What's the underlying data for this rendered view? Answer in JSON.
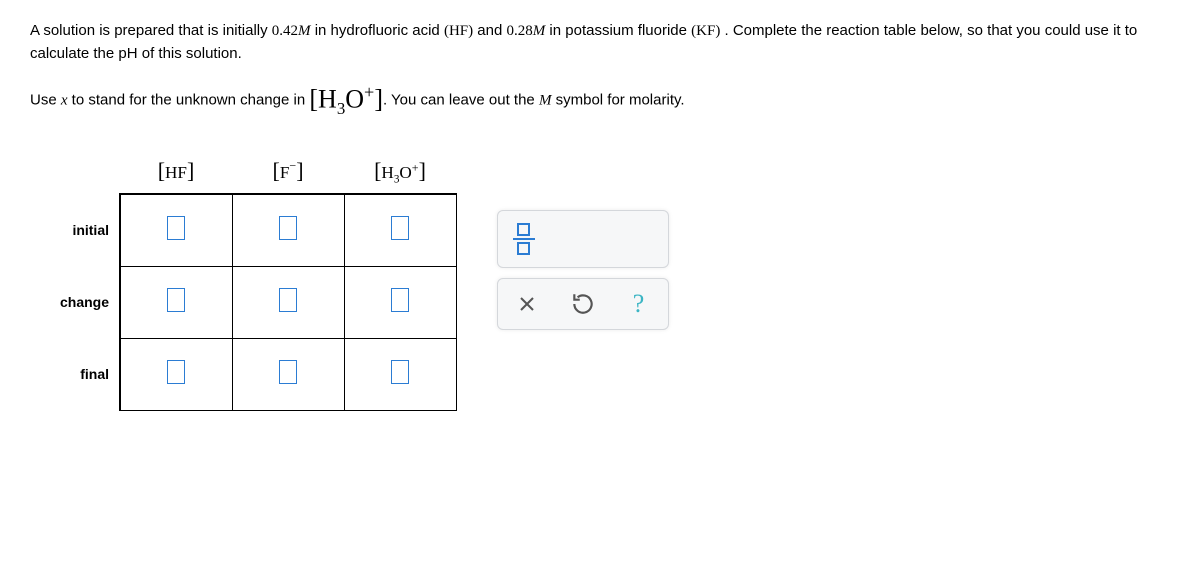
{
  "problem": {
    "part1": "A solution is prepared that is initially ",
    "conc1": "0.42",
    "unit1": "M",
    "part2": " in hydrofluoric acid ",
    "species1": "(HF)",
    "part3": "  and ",
    "conc2": "0.28",
    "unit2": "M",
    "part4": " in potassium fluoride ",
    "species2": "(KF)",
    "part5": " . Complete the reaction table below, so that you could use it to calculate the pH of this solution.",
    "line2a": "Use ",
    "xvar": "x",
    "line2b": " to stand for the unknown change in ",
    "h3o": "H",
    "h3osub": "3",
    "h3oo": "O",
    "h3osup": "+",
    "line2c": ". You can leave out the ",
    "Msym": "M",
    "line2d": " symbol for molarity."
  },
  "table": {
    "col_hf_l": "[",
    "col_hf_inner": "HF",
    "col_hf_r": "]",
    "col_f_l": "[",
    "col_f_inner": "F",
    "col_f_sup": "−",
    "col_f_r": "]",
    "col_h3o_l": "[",
    "col_h3o_h": "H",
    "col_h3o_sub": "3",
    "col_h3o_o": "O",
    "col_h3o_sup": "+",
    "col_h3o_r": "]",
    "rows": {
      "initial": "initial",
      "change": "change",
      "final": "final"
    }
  }
}
